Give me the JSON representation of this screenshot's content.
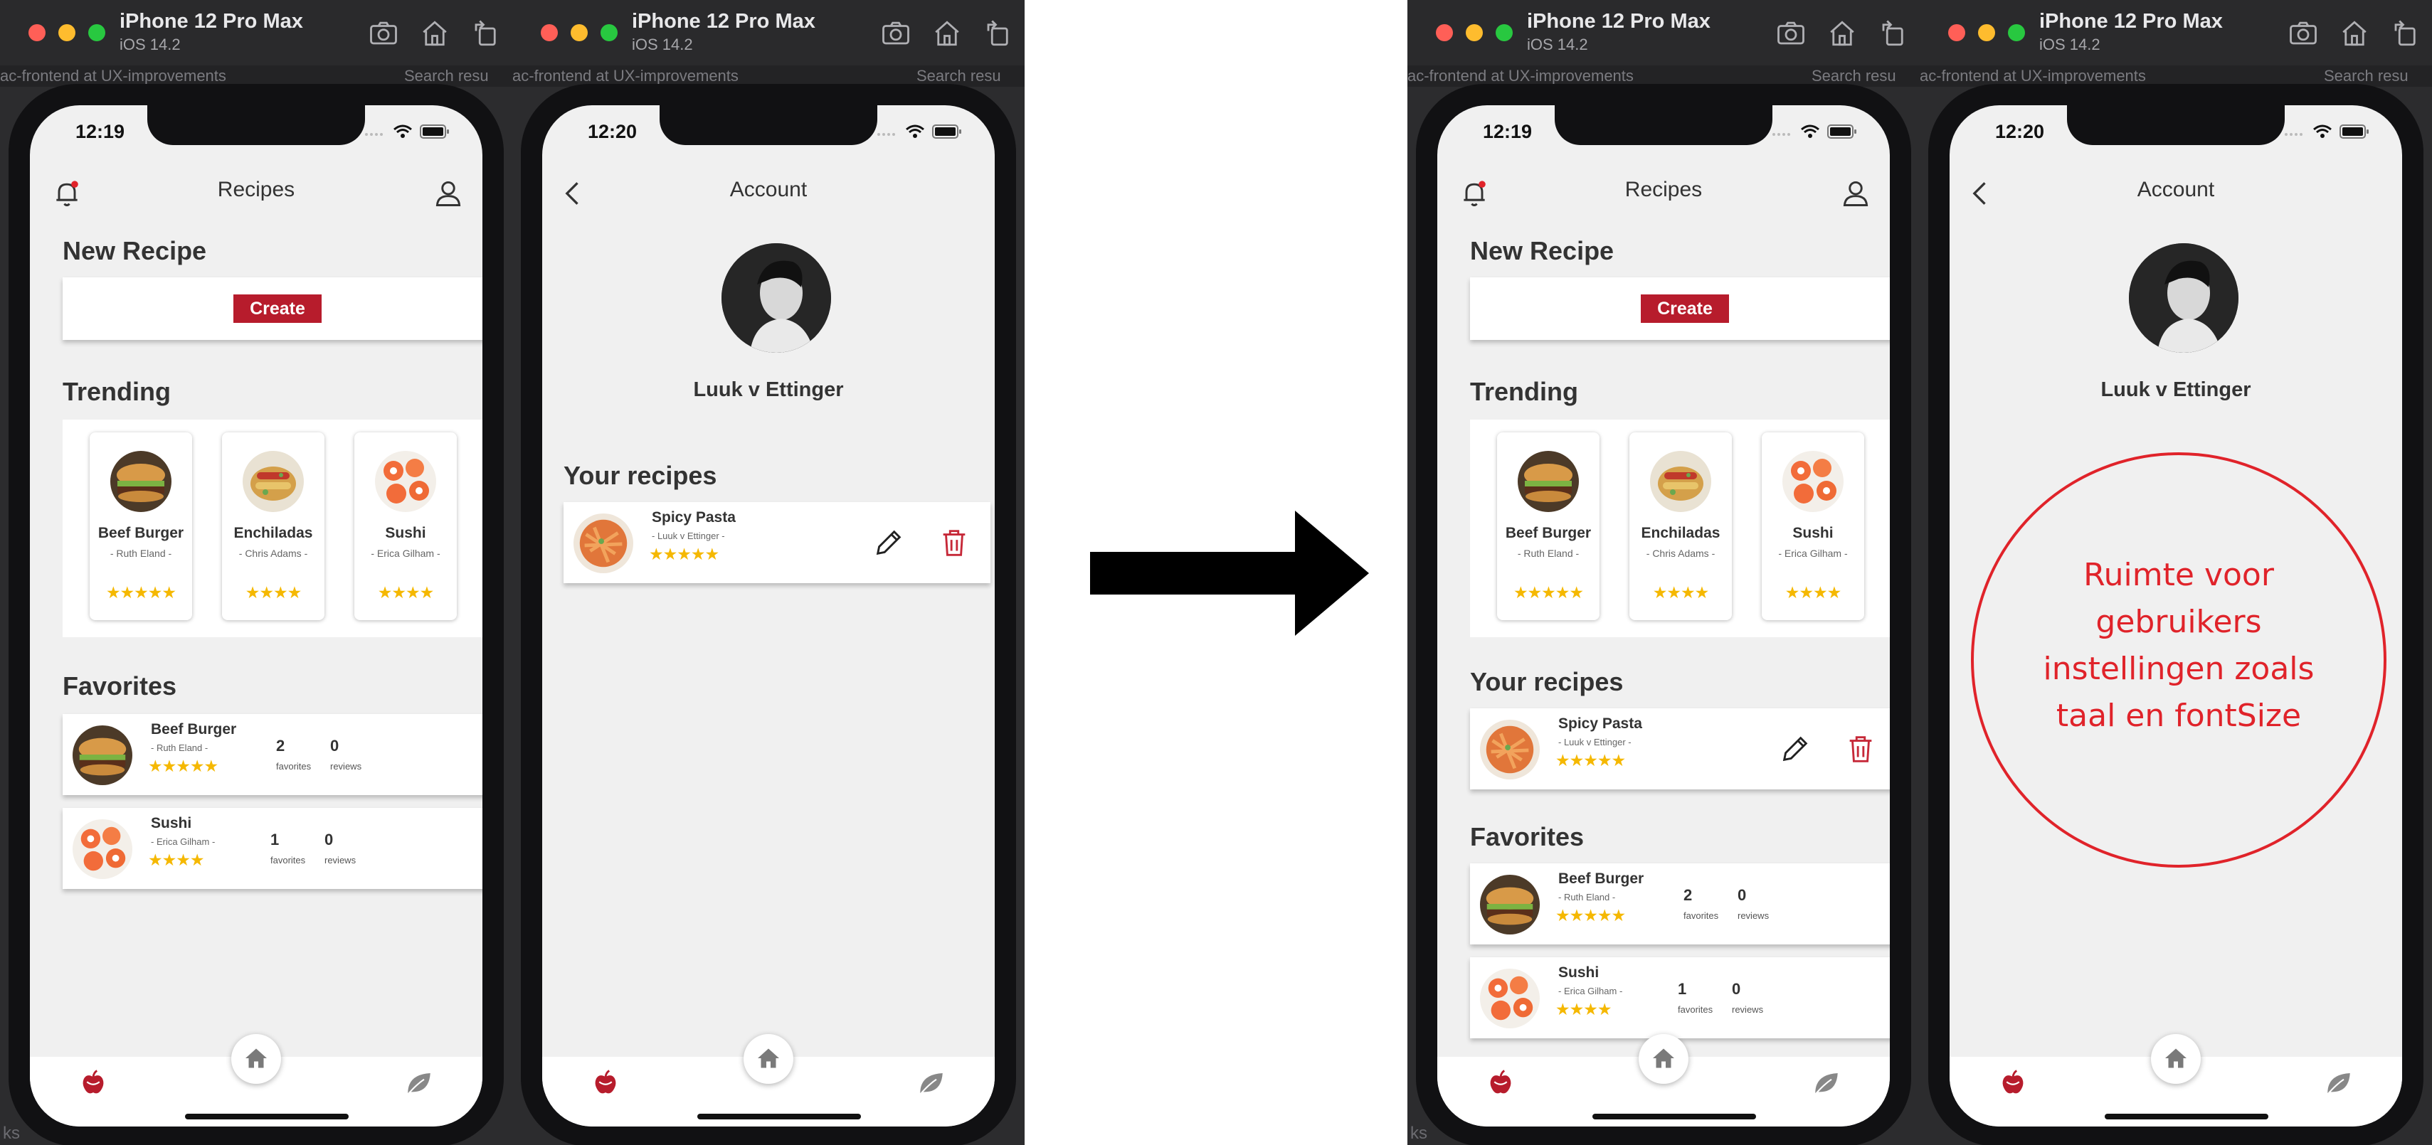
{
  "simulator": {
    "device_name": "iPhone 12 Pro Max",
    "os": "iOS 14.2",
    "window_crumb": "ac-frontend at UX-improvements",
    "window_crumb_2": "Search resu",
    "bottom_fragment": "ks"
  },
  "status": {
    "time_recipes": "12:19",
    "time_account": "12:20"
  },
  "recipes_screen": {
    "title": "Recipes",
    "new_recipe_title": "New Recipe",
    "create_label": "Create",
    "trending_title": "Trending",
    "your_recipes_title": "Your recipes",
    "favorites_title": "Favorites",
    "trending": [
      {
        "name": "Beef Burger",
        "author": "- Ruth Eland -",
        "stars": "★★★★★"
      },
      {
        "name": "Enchiladas",
        "author": "- Chris Adams -",
        "stars": "★★★★"
      },
      {
        "name": "Sushi",
        "author": "- Erica Gilham -",
        "stars": "★★★★"
      }
    ],
    "favorites": [
      {
        "name": "Beef Burger",
        "author": "- Ruth Eland -",
        "stars": "★★★★★",
        "favorites": "2",
        "favorites_label": "favorites",
        "reviews": "0",
        "reviews_label": "reviews"
      },
      {
        "name": "Sushi",
        "author": "- Erica Gilham -",
        "stars": "★★★★",
        "favorites": "1",
        "favorites_label": "favorites",
        "reviews": "0",
        "reviews_label": "reviews"
      }
    ]
  },
  "account_screen": {
    "title": "Account",
    "user_name": "Luuk v Ettinger",
    "your_recipes_title": "Your recipes",
    "recipe": {
      "name": "Spicy Pasta",
      "author": "- Luuk v Ettinger -",
      "stars": "★★★★★"
    }
  },
  "annotation": {
    "lines": [
      "Ruimte voor",
      "gebruikers",
      "instellingen zoals",
      "taal en fontSize"
    ],
    "color": "#e0232a"
  },
  "colors": {
    "accent": "#b71c2c",
    "star": "#f5b800",
    "screen_bg": "#f0f0f0"
  },
  "icons": [
    "bell-icon",
    "user-icon",
    "back-chevron-icon",
    "pencil-icon",
    "trash-icon",
    "home-icon",
    "apple-icon",
    "leaf-icon",
    "camera-icon",
    "rotate-icon",
    "right-arrow-icon"
  ]
}
